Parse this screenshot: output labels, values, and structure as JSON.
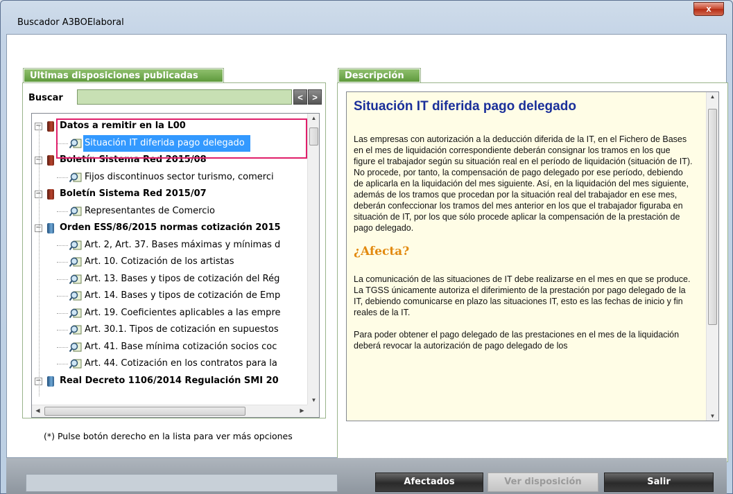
{
  "window": {
    "title": "Buscador A3BOElaboral",
    "close_glyph": "x"
  },
  "left_panel": {
    "tab_label": "Ultimas disposiciones publicadas",
    "search_label": "Buscar",
    "search_value": "",
    "prev_glyph": "<",
    "next_glyph": ">",
    "tree": [
      {
        "type": "parent",
        "label": "Datos a remitir en la L00",
        "book": "red"
      },
      {
        "type": "child",
        "label": "Situación IT diferida pago delegado",
        "selected": true
      },
      {
        "type": "parent",
        "label": "Boletín Sistema Red 2015/08",
        "book": "red"
      },
      {
        "type": "child",
        "label": "Fijos discontinuos sector turismo, comerci"
      },
      {
        "type": "parent",
        "label": "Boletín Sistema Red 2015/07",
        "book": "red"
      },
      {
        "type": "child",
        "label": "Representantes de Comercio"
      },
      {
        "type": "parent",
        "label": "Orden ESS/86/2015 normas cotización 2015",
        "book": "blue"
      },
      {
        "type": "child",
        "label": "Art. 2, Art. 37. Bases máximas y mínimas d"
      },
      {
        "type": "child",
        "label": "Art. 10. Cotización de los artistas"
      },
      {
        "type": "child",
        "label": "Art. 13. Bases y tipos de cotización del Rég"
      },
      {
        "type": "child",
        "label": "Art. 14. Bases y tipos de cotización de Emp"
      },
      {
        "type": "child",
        "label": "Art. 19. Coeficientes aplicables a las empre"
      },
      {
        "type": "child",
        "label": "Art. 30.1. Tipos de cotización en supuestos"
      },
      {
        "type": "child",
        "label": "Art. 41. Base mínima cotización socios coc"
      },
      {
        "type": "child",
        "label": "Art. 44. Cotización en los contratos para la"
      },
      {
        "type": "parent",
        "label": "Real Decreto 1106/2014 Regulación SMI 20",
        "book": "blue"
      }
    ],
    "footnote": "(*) Pulse botón derecho en la lista para ver más opciones"
  },
  "right_panel": {
    "tab_label": "Descripción",
    "title": "Situación IT diferida pago delegado",
    "paragraph_1": "Las empresas con autorización a la deducción diferida de la IT, en el Fichero de Bases en el mes de liquidación correspondiente deberán consignar los tramos en los que figure el trabajador según su situación real en el período de liquidación (situación de IT). No procede, por tanto, la compensación de pago delegado por ese período, debiendo de aplicarla en la liquidación del mes siguiente. Así, en la liquidación del mes siguiente, además de los tramos que procedan por la situación real del trabajador en ese mes, deberán confeccionar los tramos del mes anterior en los que el trabajador figuraba en situación de IT, por los que sólo procede aplicar la compensación de la prestación de pago delegado.",
    "heading_2": "¿Afecta?",
    "paragraph_2": "La comunicación de las situaciones de IT debe realizarse en el mes en que se produce. La TGSS únicamente autoriza el diferimiento de la prestación por pago delegado de la IT, debiendo comunicarse en plazo las situaciones IT, esto es las fechas de inicio y fin reales de la IT.",
    "paragraph_3": "Para poder obtener el pago delegado de las prestaciones en el mes de la liquidación deberá revocar la autorización de pago delegado de los"
  },
  "buttons": {
    "afectados": "Afectados",
    "ver_disposicion": "Ver disposición",
    "salir": "Salir"
  },
  "colors": {
    "tab_green": "#6fa84c",
    "selection_blue": "#3399ff",
    "highlight_pink": "#e01e6a",
    "desc_title_blue": "#1a2f9a",
    "desc_heading_orange": "#e28a10"
  }
}
